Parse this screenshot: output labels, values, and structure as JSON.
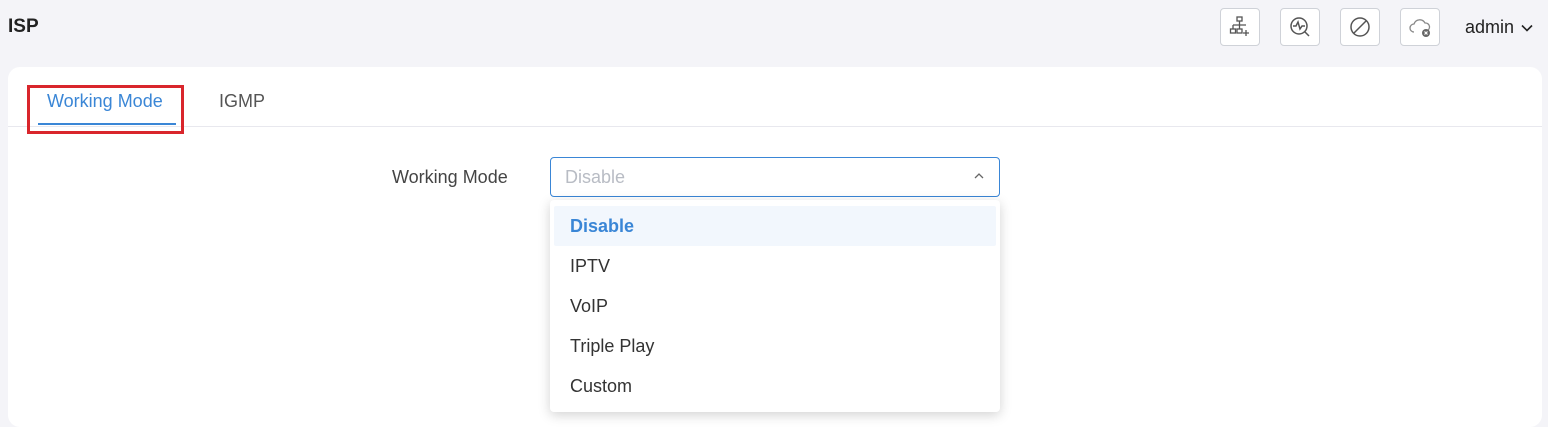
{
  "header": {
    "title": "ISP",
    "icons": [
      "network-add-icon",
      "diagnostics-icon",
      "disabled-icon",
      "cloud-disconnected-icon"
    ],
    "user": "admin"
  },
  "tabs": [
    {
      "label": "Working Mode",
      "active": true
    },
    {
      "label": "IGMP",
      "active": false
    }
  ],
  "form": {
    "working_mode_label": "Working Mode",
    "working_mode_value": "Disable",
    "options": [
      "Disable",
      "IPTV",
      "VoIP",
      "Triple Play",
      "Custom"
    ],
    "selected_option": "Disable"
  },
  "colors": {
    "accent": "#3a86d6",
    "highlight": "#d9262c"
  }
}
